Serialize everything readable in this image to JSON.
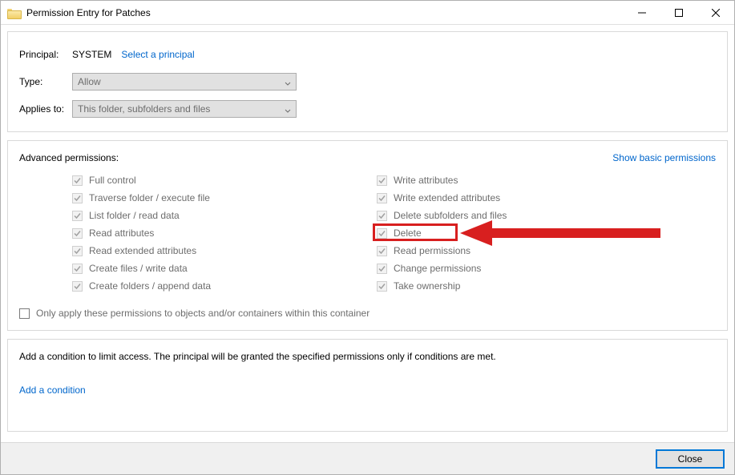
{
  "window": {
    "title": "Permission Entry for Patches"
  },
  "principal": {
    "label": "Principal:",
    "value": "SYSTEM",
    "select_link": "Select a principal"
  },
  "type": {
    "label": "Type:",
    "value": "Allow"
  },
  "applies": {
    "label": "Applies to:",
    "value": "This folder, subfolders and files"
  },
  "advanced": {
    "title": "Advanced permissions:",
    "toggle_link": "Show basic permissions",
    "col1": [
      "Full control",
      "Traverse folder / execute file",
      "List folder / read data",
      "Read attributes",
      "Read extended attributes",
      "Create files / write data",
      "Create folders / append data"
    ],
    "col2": [
      "Write attributes",
      "Write extended attributes",
      "Delete subfolders and files",
      "Delete",
      "Read permissions",
      "Change permissions",
      "Take ownership"
    ],
    "only_apply": "Only apply these permissions to objects and/or containers within this container"
  },
  "conditions": {
    "text": "Add a condition to limit access. The principal will be granted the specified permissions only if conditions are met.",
    "add_link": "Add a condition"
  },
  "buttons": {
    "close": "Close"
  },
  "annotation": {
    "highlighted_permission": "Delete"
  }
}
